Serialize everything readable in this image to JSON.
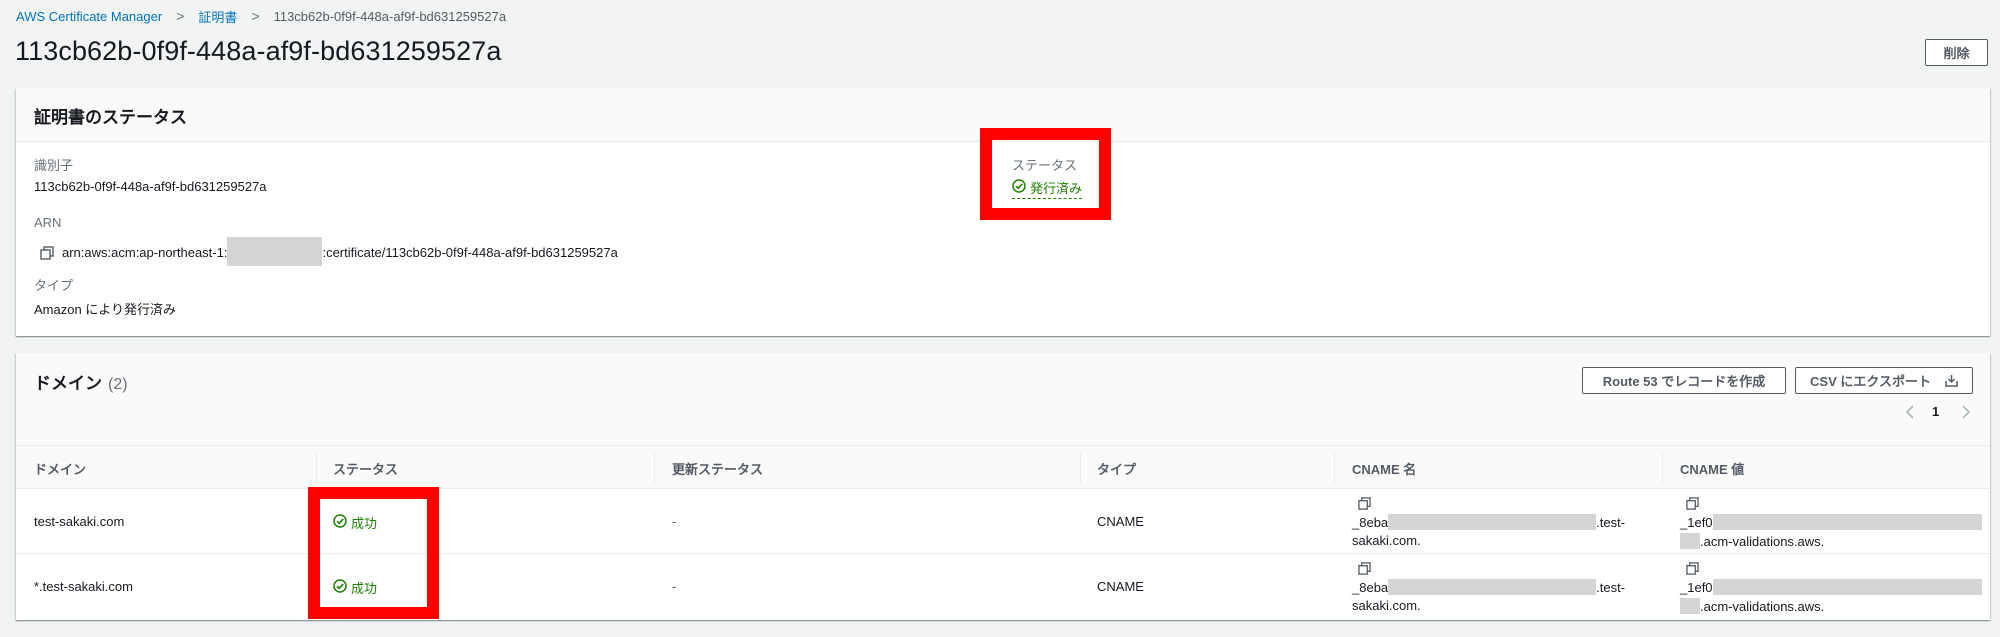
{
  "breadcrumb": {
    "items": [
      "AWS Certificate Manager",
      "証明書",
      "113cb62b-0f9f-448a-af9f-bd631259527a"
    ]
  },
  "page": {
    "title": "113cb62b-0f9f-448a-af9f-bd631259527a",
    "delete_label": "削除"
  },
  "status_panel": {
    "heading": "証明書のステータス",
    "identifier_label": "識別子",
    "identifier_value": "113cb62b-0f9f-448a-af9f-bd631259527a",
    "arn_label": "ARN",
    "arn_prefix": "arn:aws:acm:ap-northeast-1:",
    "arn_suffix": ":certificate/113cb62b-0f9f-448a-af9f-bd631259527a",
    "type_label": "タイプ",
    "type_value": "Amazon により発行済み",
    "status_label": "ステータス",
    "status_value": "発行済み"
  },
  "domains_panel": {
    "heading": "ドメイン",
    "count": "(2)",
    "route53_label": "Route 53 でレコードを作成",
    "csv_label": "CSV にエクスポート",
    "page_number": "1",
    "columns": [
      "ドメイン",
      "ステータス",
      "更新ステータス",
      "タイプ",
      "CNAME 名",
      "CNAME 値"
    ],
    "rows": [
      {
        "domain": "test-sakaki.com",
        "status": "成功",
        "renewal": "-",
        "type": "CNAME",
        "cname_name_start": "_8eba",
        "cname_name_mid": ".test-",
        "cname_name_end": "sakaki.com.",
        "cname_value_start": "_1ef0",
        "cname_value_end": ".acm-validations.aws."
      },
      {
        "domain": "*.test-sakaki.com",
        "status": "成功",
        "renewal": "-",
        "type": "CNAME",
        "cname_name_start": "_8eba",
        "cname_name_mid": ".test-",
        "cname_name_end": "sakaki.com.",
        "cname_value_start": "_1ef0",
        "cname_value_end": ".acm-validations.aws."
      }
    ]
  },
  "colors": {
    "link": "#0073bb",
    "success": "#1d8102",
    "highlight": "#ff0000"
  }
}
